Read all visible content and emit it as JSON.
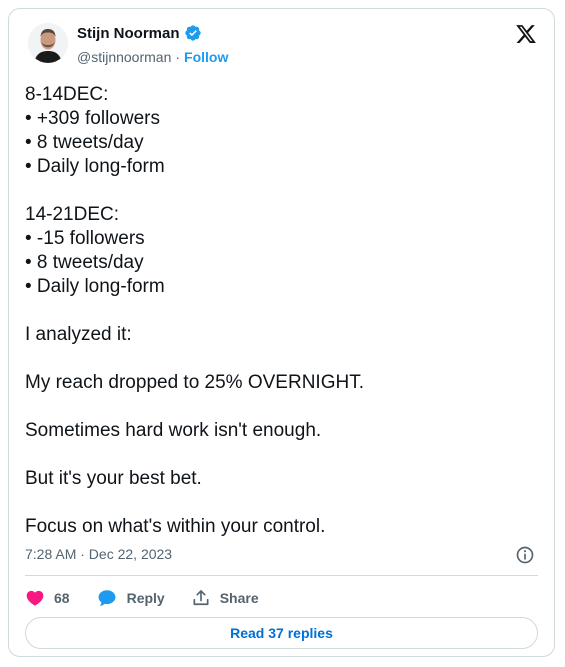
{
  "author": {
    "name": "Stijn Noorman",
    "handle": "@stijnnoorman",
    "separator": "·",
    "follow_label": "Follow"
  },
  "tweet": {
    "lines": [
      "8-14DEC:",
      "• +309 followers",
      "• 8 tweets/day",
      "• Daily long-form",
      "",
      "14-21DEC:",
      "• -15 followers",
      "• 8 tweets/day",
      "• Daily long-form",
      "",
      "I analyzed it:",
      "",
      "My reach dropped to 25% OVERNIGHT.",
      "",
      "Sometimes hard work isn't enough.",
      "",
      "But it's your best bet.",
      "",
      "Focus on what's within your control."
    ],
    "timestamp": "7:28 AM · Dec 22, 2023"
  },
  "actions": {
    "likes_count": "68",
    "reply_label": "Reply",
    "share_label": "Share",
    "read_replies_label": "Read 37 replies"
  },
  "colors": {
    "accent": "#1d9bf0",
    "like": "#f91880",
    "text": "#0f1419",
    "muted": "#536471",
    "border": "#cfd9de"
  },
  "icons": {
    "verified": "verified-badge-icon",
    "logo": "x-logo-icon",
    "info": "info-icon",
    "like": "heart-icon",
    "reply": "speech-bubble-icon",
    "share": "share-upload-icon"
  }
}
